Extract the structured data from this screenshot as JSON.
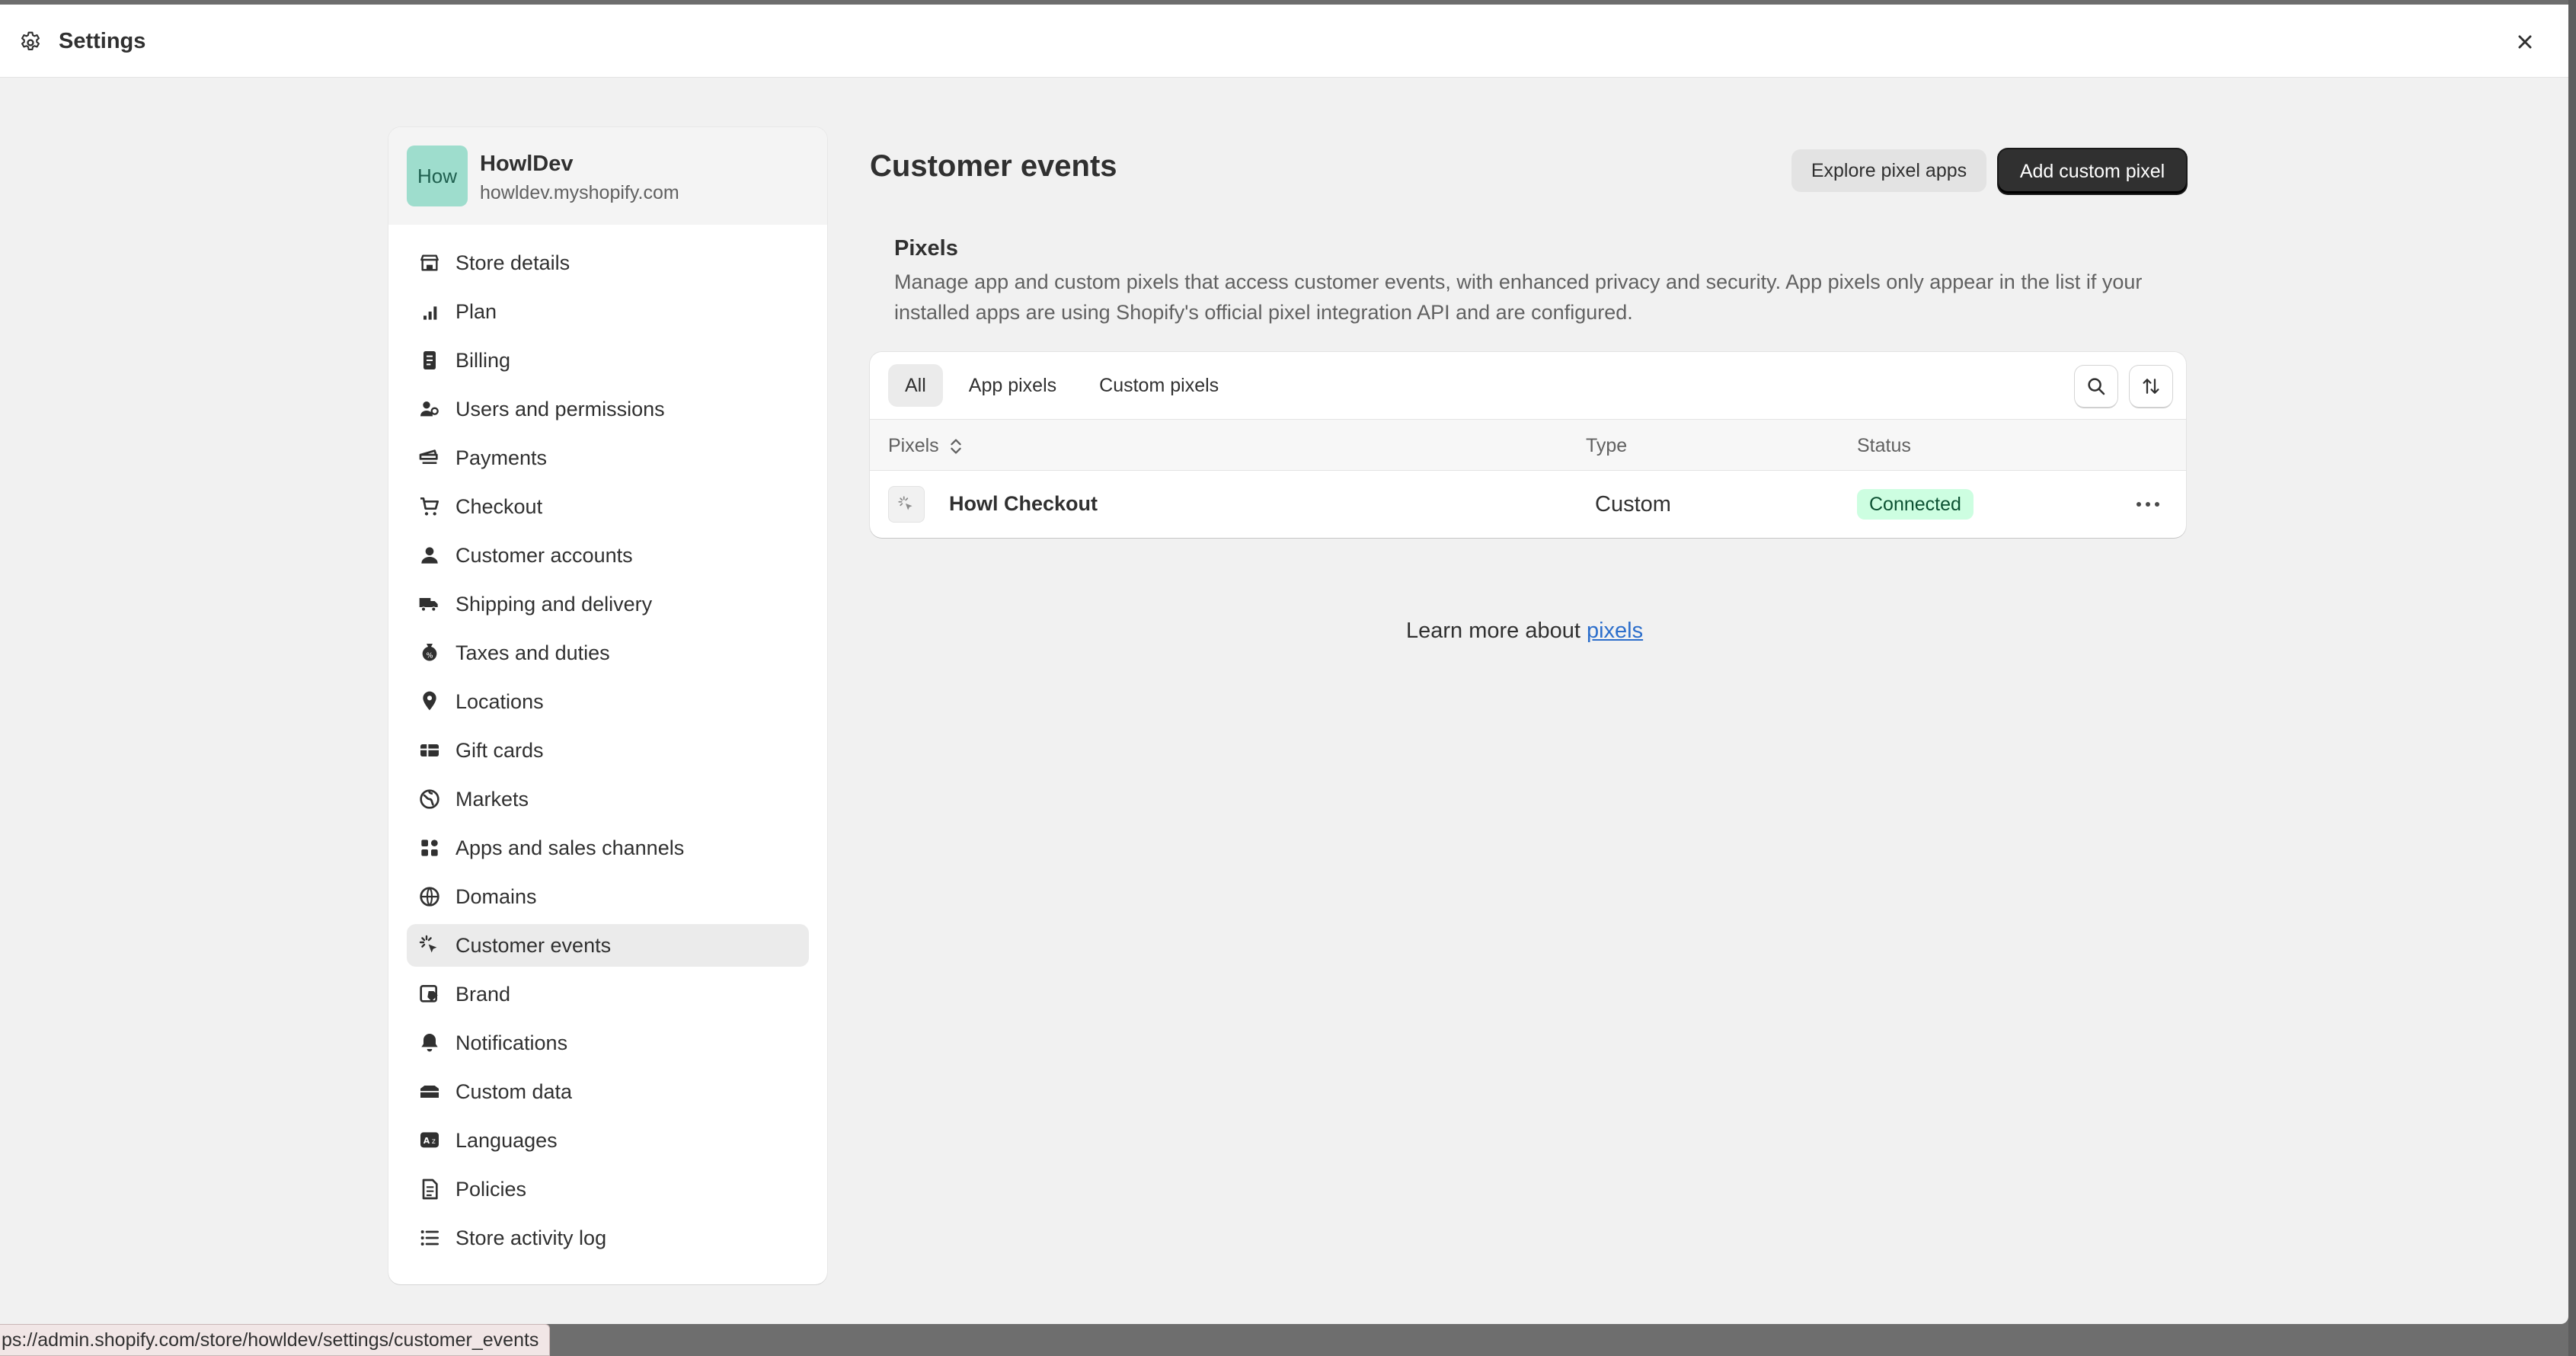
{
  "window": {
    "title": "Settings"
  },
  "store": {
    "avatar_text": "How",
    "name": "HowlDev",
    "domain": "howldev.myshopify.com"
  },
  "sidebar": {
    "items": [
      {
        "label": "Store details",
        "icon": "store-icon"
      },
      {
        "label": "Plan",
        "icon": "plan-icon"
      },
      {
        "label": "Billing",
        "icon": "billing-icon"
      },
      {
        "label": "Users and permissions",
        "icon": "users-icon"
      },
      {
        "label": "Payments",
        "icon": "payments-icon"
      },
      {
        "label": "Checkout",
        "icon": "cart-icon"
      },
      {
        "label": "Customer accounts",
        "icon": "person-icon"
      },
      {
        "label": "Shipping and delivery",
        "icon": "truck-icon"
      },
      {
        "label": "Taxes and duties",
        "icon": "tax-icon"
      },
      {
        "label": "Locations",
        "icon": "location-icon"
      },
      {
        "label": "Gift cards",
        "icon": "gift-card-icon"
      },
      {
        "label": "Markets",
        "icon": "globe-icon"
      },
      {
        "label": "Apps and sales channels",
        "icon": "apps-icon"
      },
      {
        "label": "Domains",
        "icon": "domains-icon"
      },
      {
        "label": "Customer events",
        "icon": "cursor-click-icon",
        "active": true
      },
      {
        "label": "Brand",
        "icon": "brand-icon"
      },
      {
        "label": "Notifications",
        "icon": "bell-icon"
      },
      {
        "label": "Custom data",
        "icon": "custom-data-icon"
      },
      {
        "label": "Languages",
        "icon": "language-icon"
      },
      {
        "label": "Policies",
        "icon": "policies-icon"
      },
      {
        "label": "Store activity log",
        "icon": "list-icon"
      }
    ]
  },
  "main": {
    "title": "Customer events",
    "explore_button": "Explore pixel apps",
    "add_button": "Add custom pixel",
    "section_title": "Pixels",
    "section_desc": "Manage app and custom pixels that access customer events, with enhanced privacy and security. App pixels only appear in the list if your installed apps are using Shopify's official pixel integration API and are configured.",
    "tabs": [
      "All",
      "App pixels",
      "Custom pixels"
    ],
    "columns": {
      "pixels": "Pixels",
      "type": "Type",
      "status": "Status"
    },
    "rows": [
      {
        "name": "Howl Checkout",
        "type": "Custom",
        "status": "Connected"
      }
    ],
    "learn_prefix": "Learn more about ",
    "learn_link": "pixels"
  },
  "statusbar": {
    "url": "ps://admin.shopify.com/store/howldev/settings/customer_events"
  },
  "colors": {
    "accent_dark": "#303030",
    "badge_bg": "#cdfee1",
    "badge_text": "#0c5132",
    "link": "#2c6ecb",
    "avatar_bg": "#9eddcd"
  }
}
